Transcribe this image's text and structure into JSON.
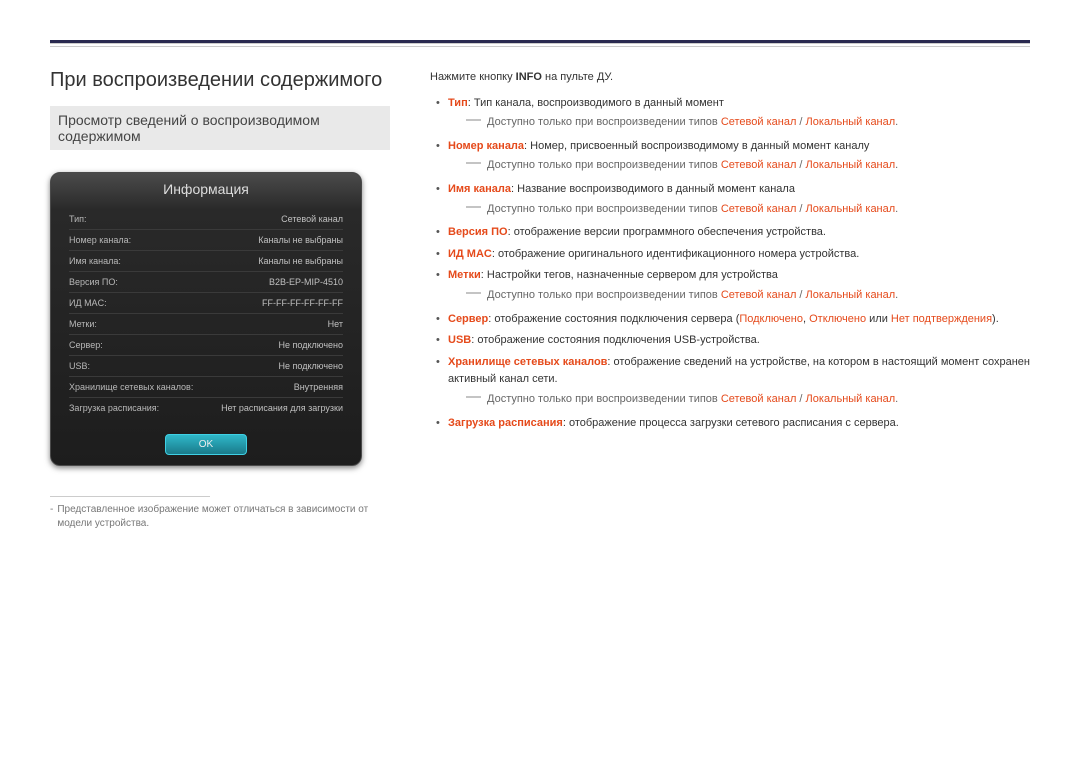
{
  "page": {
    "title": "При воспроизведении содержимого",
    "subtitle": "Просмотр сведений о воспроизводимом содержимом"
  },
  "panel": {
    "title": "Информация",
    "rows": [
      {
        "label": "Тип:",
        "value": "Сетевой канал"
      },
      {
        "label": "Номер канала:",
        "value": "Каналы не выбраны"
      },
      {
        "label": "Имя канала:",
        "value": "Каналы не выбраны"
      },
      {
        "label": "Версия ПО:",
        "value": "B2B-EP-MIP-4510"
      },
      {
        "label": "ИД MAC:",
        "value": "FF-FF-FF-FF-FF-FF"
      },
      {
        "label": "Метки:",
        "value": "Нет"
      },
      {
        "label": "Сервер:",
        "value": "Не подключено"
      },
      {
        "label": "USB:",
        "value": "Не подключено"
      },
      {
        "label": "Хранилище сетевых каналов:",
        "value": "Внутренняя"
      },
      {
        "label": "Загрузка расписания:",
        "value": "Нет расписания для загрузки"
      }
    ],
    "ok": "OK"
  },
  "footnote": {
    "marker": "-",
    "text": "Представленное изображение может отличаться в зависимости от модели устройства."
  },
  "right": {
    "intro_pre": "Нажмите кнопку ",
    "intro_bold": "INFO",
    "intro_post": " на пульте ДУ.",
    "common_sub_pre": "Доступно только при воспроизведении типов ",
    "common_sub_red": "Сетевой канал",
    "common_sub_slash": " / ",
    "common_sub_red2": "Локальный канал",
    "common_sub_end": ".",
    "items": {
      "tip": {
        "strong": "Тип",
        "text": ": Тип канала, воспроизводимого в данный момент"
      },
      "chnum": {
        "strong": "Номер канала",
        "text": ": Номер, присвоенный воспроизводимому в данный момент каналу"
      },
      "chname": {
        "strong": "Имя канала",
        "text": ": Название воспроизводимого в данный момент канала"
      },
      "ver": {
        "strong": "Версия ПО",
        "text": ": отображение версии программного обеспечения устройства."
      },
      "mac": {
        "strong": "ИД MAC",
        "text": ": отображение оригинального идентификационного номера устройства."
      },
      "tags": {
        "strong": "Метки",
        "text": ": Настройки тегов, назначенные сервером для устройства"
      },
      "server": {
        "strong": "Сервер",
        "text_pre": ": отображение состояния подключения сервера (",
        "r1": "Подключено",
        "c1": ", ",
        "r2": "Отключено",
        "c2": " или ",
        "r3": "Нет подтверждения",
        "text_post": ")."
      },
      "usb": {
        "strong": "USB",
        "text": ": отображение состояния подключения USB-устройства."
      },
      "store": {
        "strong": "Хранилище сетевых каналов",
        "text": ": отображение сведений на устройстве, на котором в настоящий момент сохранен активный канал сети."
      },
      "sched": {
        "strong": "Загрузка расписания",
        "text": ": отображение процесса загрузки сетевого расписания с сервера."
      }
    }
  }
}
